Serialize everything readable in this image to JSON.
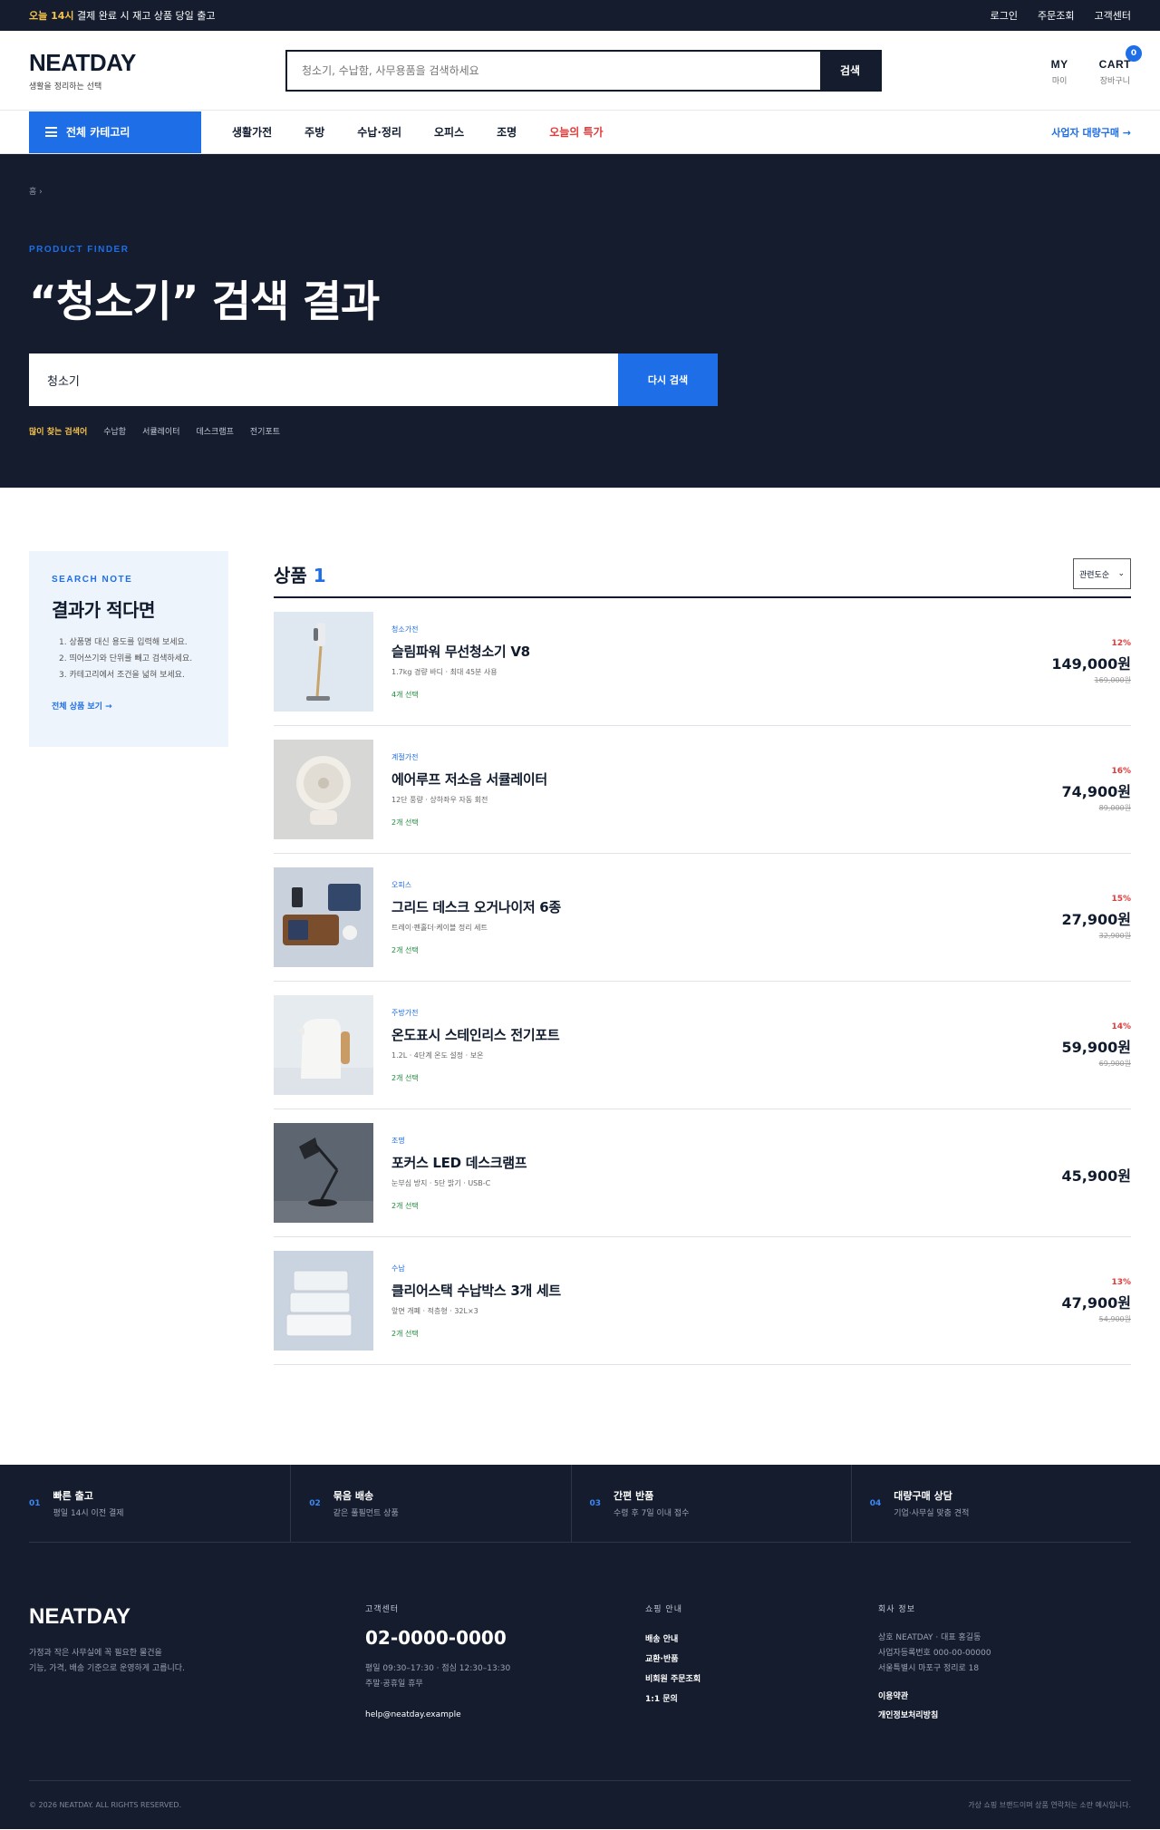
{
  "topbar": {
    "highlight": "오늘 14시",
    "notice": " 결제 완료 시 재고 상품 당일 출고",
    "links": [
      "로그인",
      "주문조회",
      "고객센터"
    ]
  },
  "brand": {
    "name": "NEATDAY",
    "tagline": "생활을 정리하는 선택"
  },
  "search": {
    "placeholder": "청소기, 수납함, 사무용품을 검색하세요",
    "button": "검색"
  },
  "header_icons": {
    "my_title": "MY",
    "my_sub": "마이",
    "cart_title": "CART",
    "cart_sub": "장바구니",
    "cart_count": "0"
  },
  "nav": {
    "all_categories": "전체 카테고리",
    "items": [
      "생활가전",
      "주방",
      "수납·정리",
      "오피스",
      "조명"
    ],
    "sale": "오늘의 특가",
    "bulk": "사업자 대량구매 →"
  },
  "hero": {
    "breadcrumb": "홈 ›",
    "kicker": "PRODUCT FINDER",
    "title": "“청소기” 검색 결과",
    "query": "청소기",
    "research": "다시 검색",
    "popular_label": "많이 찾는 검색어",
    "popular": [
      "수납함",
      "서큘레이터",
      "데스크램프",
      "전기포트"
    ]
  },
  "note": {
    "kicker": "SEARCH NOTE",
    "title": "결과가 적다면",
    "tips": [
      "1. 상품명 대신 용도를 입력해 보세요.",
      "2. 띄어쓰기와 단위를 빼고 검색하세요.",
      "3. 카테고리에서 조건을 넓혀 보세요."
    ],
    "more": "전체 상품 보기 →"
  },
  "results": {
    "label": "상품",
    "count": "1",
    "sort": "관련도순"
  },
  "products": [
    {
      "category": "청소가전",
      "name": "슬림파워 무선청소기 V8",
      "spec": "1.7kg 경량 바디 · 최대 45분 사용",
      "options": "4개 선택",
      "discount": "12%",
      "price": "149,000원",
      "original": "169,000원"
    },
    {
      "category": "계절가전",
      "name": "에어루프 저소음 서큘레이터",
      "spec": "12단 풍량 · 상하좌우 자동 회전",
      "options": "2개 선택",
      "discount": "16%",
      "price": "74,900원",
      "original": "89,000원"
    },
    {
      "category": "오피스",
      "name": "그리드 데스크 오거나이저 6종",
      "spec": "트레이·펜홀더·케이블 정리 세트",
      "options": "2개 선택",
      "discount": "15%",
      "price": "27,900원",
      "original": "32,900원"
    },
    {
      "category": "주방가전",
      "name": "온도표시 스테인리스 전기포트",
      "spec": "1.2L · 4단계 온도 설정 · 보온",
      "options": "2개 선택",
      "discount": "14%",
      "price": "59,900원",
      "original": "69,900원"
    },
    {
      "category": "조명",
      "name": "포커스 LED 데스크램프",
      "spec": "눈부심 방지 · 5단 밝기 · USB-C",
      "options": "2개 선택",
      "discount": "",
      "price": "45,900원",
      "original": ""
    },
    {
      "category": "수납",
      "name": "클리어스택 수납박스 3개 세트",
      "spec": "앞면 개폐 · 적층형 · 32L×3",
      "options": "2개 선택",
      "discount": "13%",
      "price": "47,900원",
      "original": "54,900원"
    }
  ],
  "features": [
    {
      "num": "01",
      "title": "빠른 출고",
      "sub": "평일 14시 이전 결제"
    },
    {
      "num": "02",
      "title": "묶음 배송",
      "sub": "같은 풀필먼트 상품"
    },
    {
      "num": "03",
      "title": "간편 반품",
      "sub": "수령 후 7일 이내 접수"
    },
    {
      "num": "04",
      "title": "대량구매 상담",
      "sub": "기업·사무실 맞춤 견적"
    }
  ],
  "footer": {
    "logo": "NEATDAY",
    "desc1": "가정과 작은 사무실에 꼭 필요한 물건을",
    "desc2": "기능, 가격, 배송 기준으로 운영하게 고릅니다.",
    "cs_head": "고객센터",
    "phone": "02-0000-0000",
    "hours": "평일 09:30–17:30 · 점심 12:30–13:30",
    "holiday": "주말·공휴일 휴무",
    "email": "help@neatday.example",
    "shop_head": "쇼핑 안내",
    "shop_links": [
      "배송 안내",
      "교환·반품",
      "비회원 주문조회",
      "1:1 문의"
    ],
    "co_head": "회사 정보",
    "co1": "상호 NEATDAY · 대표 홍길동",
    "co2": "사업자등록번호 000-00-00000",
    "co3": "서울특별시 마포구 정리로 18",
    "terms": "이용약관",
    "privacy": "개인정보처리방침",
    "copyright": "© 2026 NEATDAY. ALL RIGHTS RESERVED.",
    "disclaimer": "가상 쇼핑 브랜드이며 상품 연락처는 소란 예시입니다."
  },
  "colors": {
    "accent": "#1e6ee8",
    "navy": "#141c2e",
    "sale": "#e23b3b",
    "highlight": "#f5c24b"
  }
}
